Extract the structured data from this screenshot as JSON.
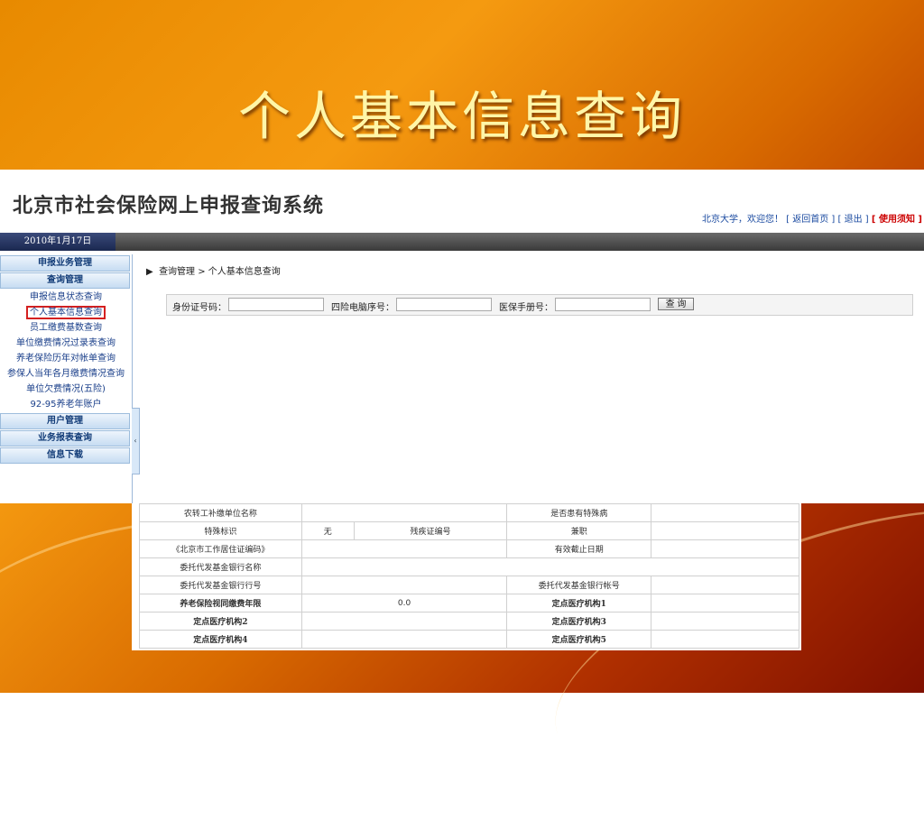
{
  "slide": {
    "title": "个人基本信息查询"
  },
  "app": {
    "logo": "北京市社会保险网上申报查询系统",
    "welcome": {
      "user": "北京大学，欢迎您！",
      "home": "[ 返回首页 ]",
      "logout": "[ 退出 ]",
      "notice": "[ 使用须知 ]"
    },
    "date": "2010年1月17日"
  },
  "sidebar": {
    "sections": [
      {
        "label": "申报业务管理"
      },
      {
        "label": "查询管理"
      }
    ],
    "items": [
      {
        "label": "申报信息状态查询"
      },
      {
        "label": "个人基本信息查询"
      },
      {
        "label": "员工缴费基数查询"
      },
      {
        "label": "单位缴费情况过录表查询"
      },
      {
        "label": "养老保险历年对帐单查询"
      },
      {
        "label": "参保人当年各月缴费情况查询"
      },
      {
        "label": "单位欠费情况(五险)"
      },
      {
        "label": "92-95养老年账户"
      }
    ],
    "bottom_sections": [
      {
        "label": "用户管理"
      },
      {
        "label": "业务报表查询"
      },
      {
        "label": "信息下载"
      }
    ]
  },
  "breadcrumb": {
    "arrow": "▶",
    "text": "查询管理 > 个人基本信息查询"
  },
  "search": {
    "id_label": "身份证号码：",
    "pc_label": "四险电脑序号：",
    "med_label": "医保手册号：",
    "button": "查 询"
  },
  "table": {
    "rows": [
      [
        "农转工补缴单位名称",
        "",
        "",
        "是否患有特殊病",
        ""
      ],
      [
        "特殊标识",
        "无",
        "残疾证编号",
        "兼职",
        ""
      ],
      [
        "《北京市工作居住证编码》",
        "",
        "",
        "有效截止日期",
        ""
      ],
      [
        "委托代发基金银行名称",
        "",
        "",
        "",
        ""
      ],
      [
        "委托代发基金银行行号",
        "",
        "",
        "委托代发基金银行帐号",
        ""
      ],
      [
        "养老保险视同缴费年限",
        "0.0",
        "",
        "定点医疗机构1",
        ""
      ],
      [
        "定点医疗机构2",
        "",
        "",
        "定点医疗机构3",
        ""
      ],
      [
        "定点医疗机构4",
        "",
        "",
        "定点医疗机构5",
        ""
      ]
    ]
  }
}
